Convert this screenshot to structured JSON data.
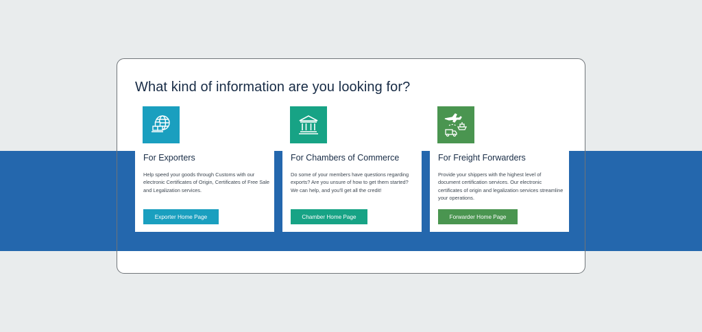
{
  "heading": "What kind of information are you looking for?",
  "cards": [
    {
      "title": "For Exporters",
      "text": "Help speed your goods through Customs with our electronic Certificates of Origin, Certificates of Free Sale and Legalization services.",
      "button": "Exporter Home Page",
      "icon": "globe-with-boxes-icon",
      "color": "#1a9fbf"
    },
    {
      "title": "For Chambers of Commerce",
      "text": "Do some of your members have questions regarding exports? Are you unsure of how to get them started? We can help, and you'll get all the credit!",
      "button": "Chamber Home Page",
      "icon": "government-building-icon",
      "color": "#17a385"
    },
    {
      "title": "For Freight Forwarders",
      "text": "Provide your shippers with the highest level of document certification services. Our electronic certificates of origin and legalization services streamline your operations.",
      "button": "Forwarder Home Page",
      "icon": "plane-ship-truck-icon",
      "color": "#4a9550"
    }
  ],
  "colors": {
    "band": "#2467ad",
    "background": "#e9eced",
    "heading": "#172b45"
  }
}
